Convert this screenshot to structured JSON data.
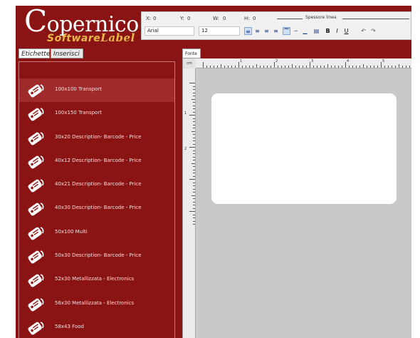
{
  "brand": {
    "name_cap": "C",
    "name_rest": "opernico",
    "sub_word1": "Software",
    "sub_word2": "Label"
  },
  "toolbar": {
    "x_label": "X:",
    "x_value": "0",
    "y_label": "Y:",
    "y_value": "0",
    "w_label": "W:",
    "w_value": "0",
    "h_label": "H:",
    "h_value": "0",
    "line_label": "Spessore linea",
    "font_value": "Arial",
    "size_value": "12",
    "bold": "B",
    "italic": "I",
    "underline": "U"
  },
  "tabs": [
    {
      "label": "Etichette"
    },
    {
      "label": "Inserisci"
    }
  ],
  "document_tab": "Fonte",
  "ruler": {
    "corner": "cm",
    "top_numbers": [
      "1",
      "2",
      "3",
      "4",
      "5"
    ],
    "left_numbers": [
      "1",
      "2"
    ]
  },
  "labels": [
    {
      "label": "100x100 Transport",
      "selected": true
    },
    {
      "label": "100x150 Transport",
      "selected": false
    },
    {
      "label": "30x20 Description- Barcode - Price",
      "selected": false
    },
    {
      "label": "40x12 Description- Barcode - Price",
      "selected": false
    },
    {
      "label": "40x21 Description- Barcode - Price",
      "selected": false
    },
    {
      "label": "40x30 Description- Barcode - Price",
      "selected": false
    },
    {
      "label": "50x100 Multi",
      "selected": false
    },
    {
      "label": "50x30 Description- Barcode - Price",
      "selected": false
    },
    {
      "label": "52x30 Metallizzata - Electronics",
      "selected": false
    },
    {
      "label": "56x30 Metallizzata - Electronics",
      "selected": false
    },
    {
      "label": "58x43 Food",
      "selected": false
    }
  ],
  "colors": {
    "brand_red": "#8a1414",
    "accent_gold": "#e8b74a",
    "canvas_bg": "#c9c9c9"
  }
}
